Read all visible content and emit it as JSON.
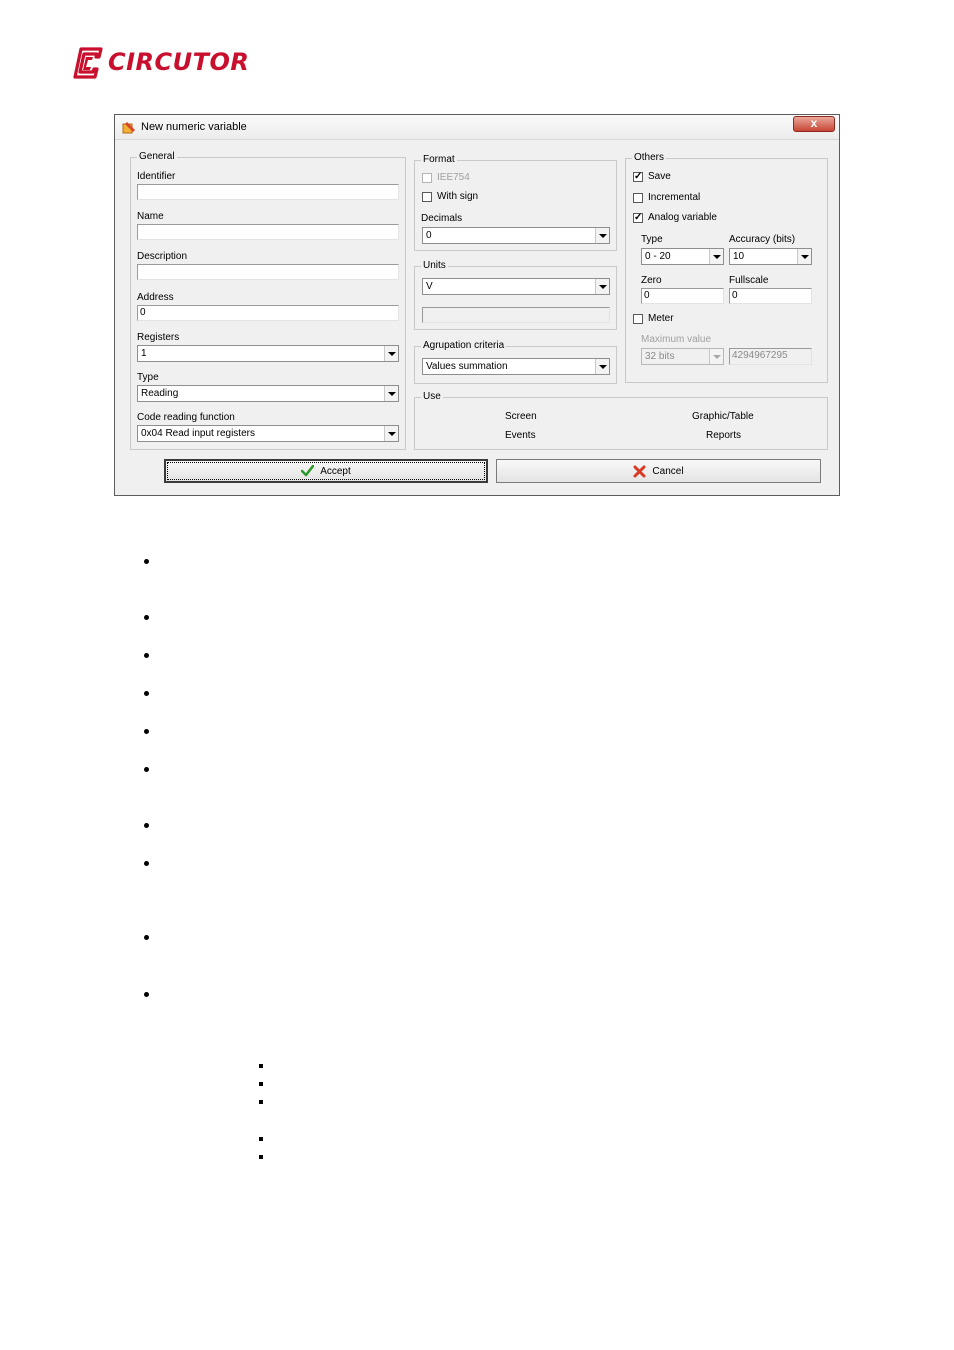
{
  "brand": {
    "name": "CIRCUTOR",
    "color": "#c8102e"
  },
  "dialog": {
    "title": "New numeric variable",
    "close_label": "x",
    "general": {
      "legend": "General",
      "identifier_label": "Identifier",
      "identifier_value": "",
      "name_label": "Name",
      "name_value": "",
      "description_label": "Description",
      "description_value": "",
      "address_label": "Address",
      "address_value": "0",
      "registers_label": "Registers",
      "registers_value": "1",
      "type_label": "Type",
      "type_value": "Reading",
      "code_label": "Code reading function",
      "code_value": "0x04 Read input registers"
    },
    "format": {
      "legend": "Format",
      "iee754_label": "IEE754",
      "iee754_checked": false,
      "with_sign_label": "With sign",
      "with_sign_checked": false,
      "decimals_label": "Decimals",
      "decimals_value": "0"
    },
    "units": {
      "legend": "Units",
      "value": "V",
      "custom_value": ""
    },
    "agrupation": {
      "legend": "Agrupation criteria",
      "value": "Values summation"
    },
    "use": {
      "legend": "Use",
      "screen": "Screen",
      "graphic_table": "Graphic/Table",
      "events": "Events",
      "reports": "Reports"
    },
    "others": {
      "legend": "Others",
      "save_label": "Save",
      "save_checked": true,
      "incremental_label": "Incremental",
      "incremental_checked": false,
      "analog_label": "Analog variable",
      "analog_checked": true,
      "type_label": "Type",
      "type_value": "0 - 20",
      "accuracy_label": "Accuracy (bits)",
      "accuracy_value": "10",
      "zero_label": "Zero",
      "zero_value": "0",
      "fullscale_label": "Fullscale",
      "fullscale_value": "0",
      "meter_label": "Meter",
      "meter_checked": false,
      "max_label": "Maximum value",
      "max_bits_value": "32 bits",
      "max_value": "4294967295"
    },
    "accept_label": "Accept",
    "cancel_label": "Cancel"
  }
}
